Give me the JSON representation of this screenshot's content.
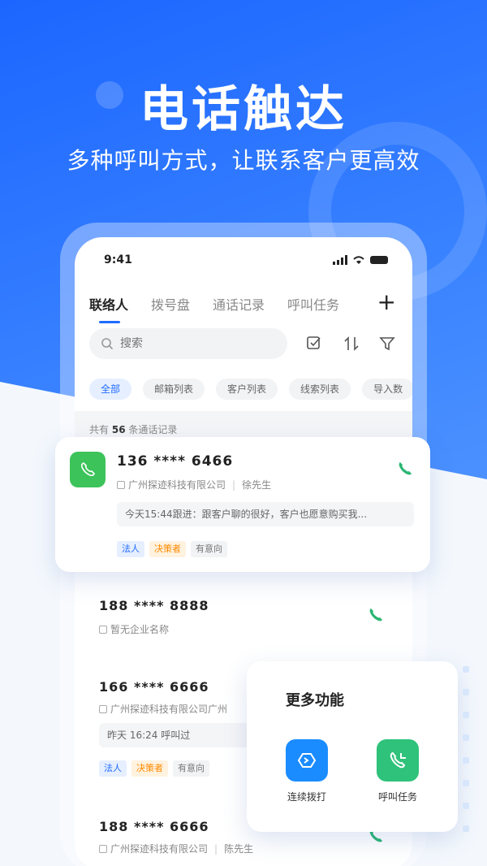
{
  "hero": {
    "title": "电话触达",
    "subtitle": "多种呼叫方式，让联系客户更高效"
  },
  "status_bar": {
    "time": "9:41"
  },
  "tabs": [
    {
      "label": "联络人",
      "active": true
    },
    {
      "label": "拨号盘",
      "active": false
    },
    {
      "label": "通话记录",
      "active": false
    },
    {
      "label": "呼叫任务",
      "active": false
    }
  ],
  "add_icon": "plus-icon",
  "search": {
    "placeholder": "搜索"
  },
  "toolbar_icons": [
    "checklist-icon",
    "sort-icon",
    "filter-icon"
  ],
  "chips": [
    {
      "label": "全部",
      "active": true
    },
    {
      "label": "邮箱列表",
      "active": false
    },
    {
      "label": "客户列表",
      "active": false
    },
    {
      "label": "线索列表",
      "active": false
    },
    {
      "label": "导入数",
      "active": false
    }
  ],
  "count": {
    "prefix": "共有",
    "value": "56",
    "suffix": "条通话记录"
  },
  "highlight_card": {
    "number": "136 **** 6466",
    "company": "广州探迹科技有限公司",
    "contact": "徐先生",
    "followup": "今天15:44跟进：跟客户聊的很好，客户也愿意购买我...",
    "tags": [
      "法人",
      "决策者",
      "有意向"
    ],
    "colors": {
      "badge": "#3cc35a",
      "call": "#2bb673"
    }
  },
  "list": [
    {
      "number": "188 **** 8888",
      "company": "暂无企业名称"
    },
    {
      "number": "166 **** 6666",
      "company": "广州探迹科技有限公司广州",
      "followup": "昨天 16:24 呼叫过",
      "tags": [
        "法人",
        "决策者",
        "有意向"
      ]
    },
    {
      "number": "188 **** 6666",
      "company": "广州探迹科技有限公司",
      "contact": "陈先生"
    }
  ],
  "more_functions": {
    "title": "更多功能",
    "items": [
      {
        "label": "连续拨打",
        "icon": "continuous-dial-icon",
        "color": "#1a8cff"
      },
      {
        "label": "呼叫任务",
        "icon": "call-task-icon",
        "color": "#2fc27a"
      }
    ]
  }
}
